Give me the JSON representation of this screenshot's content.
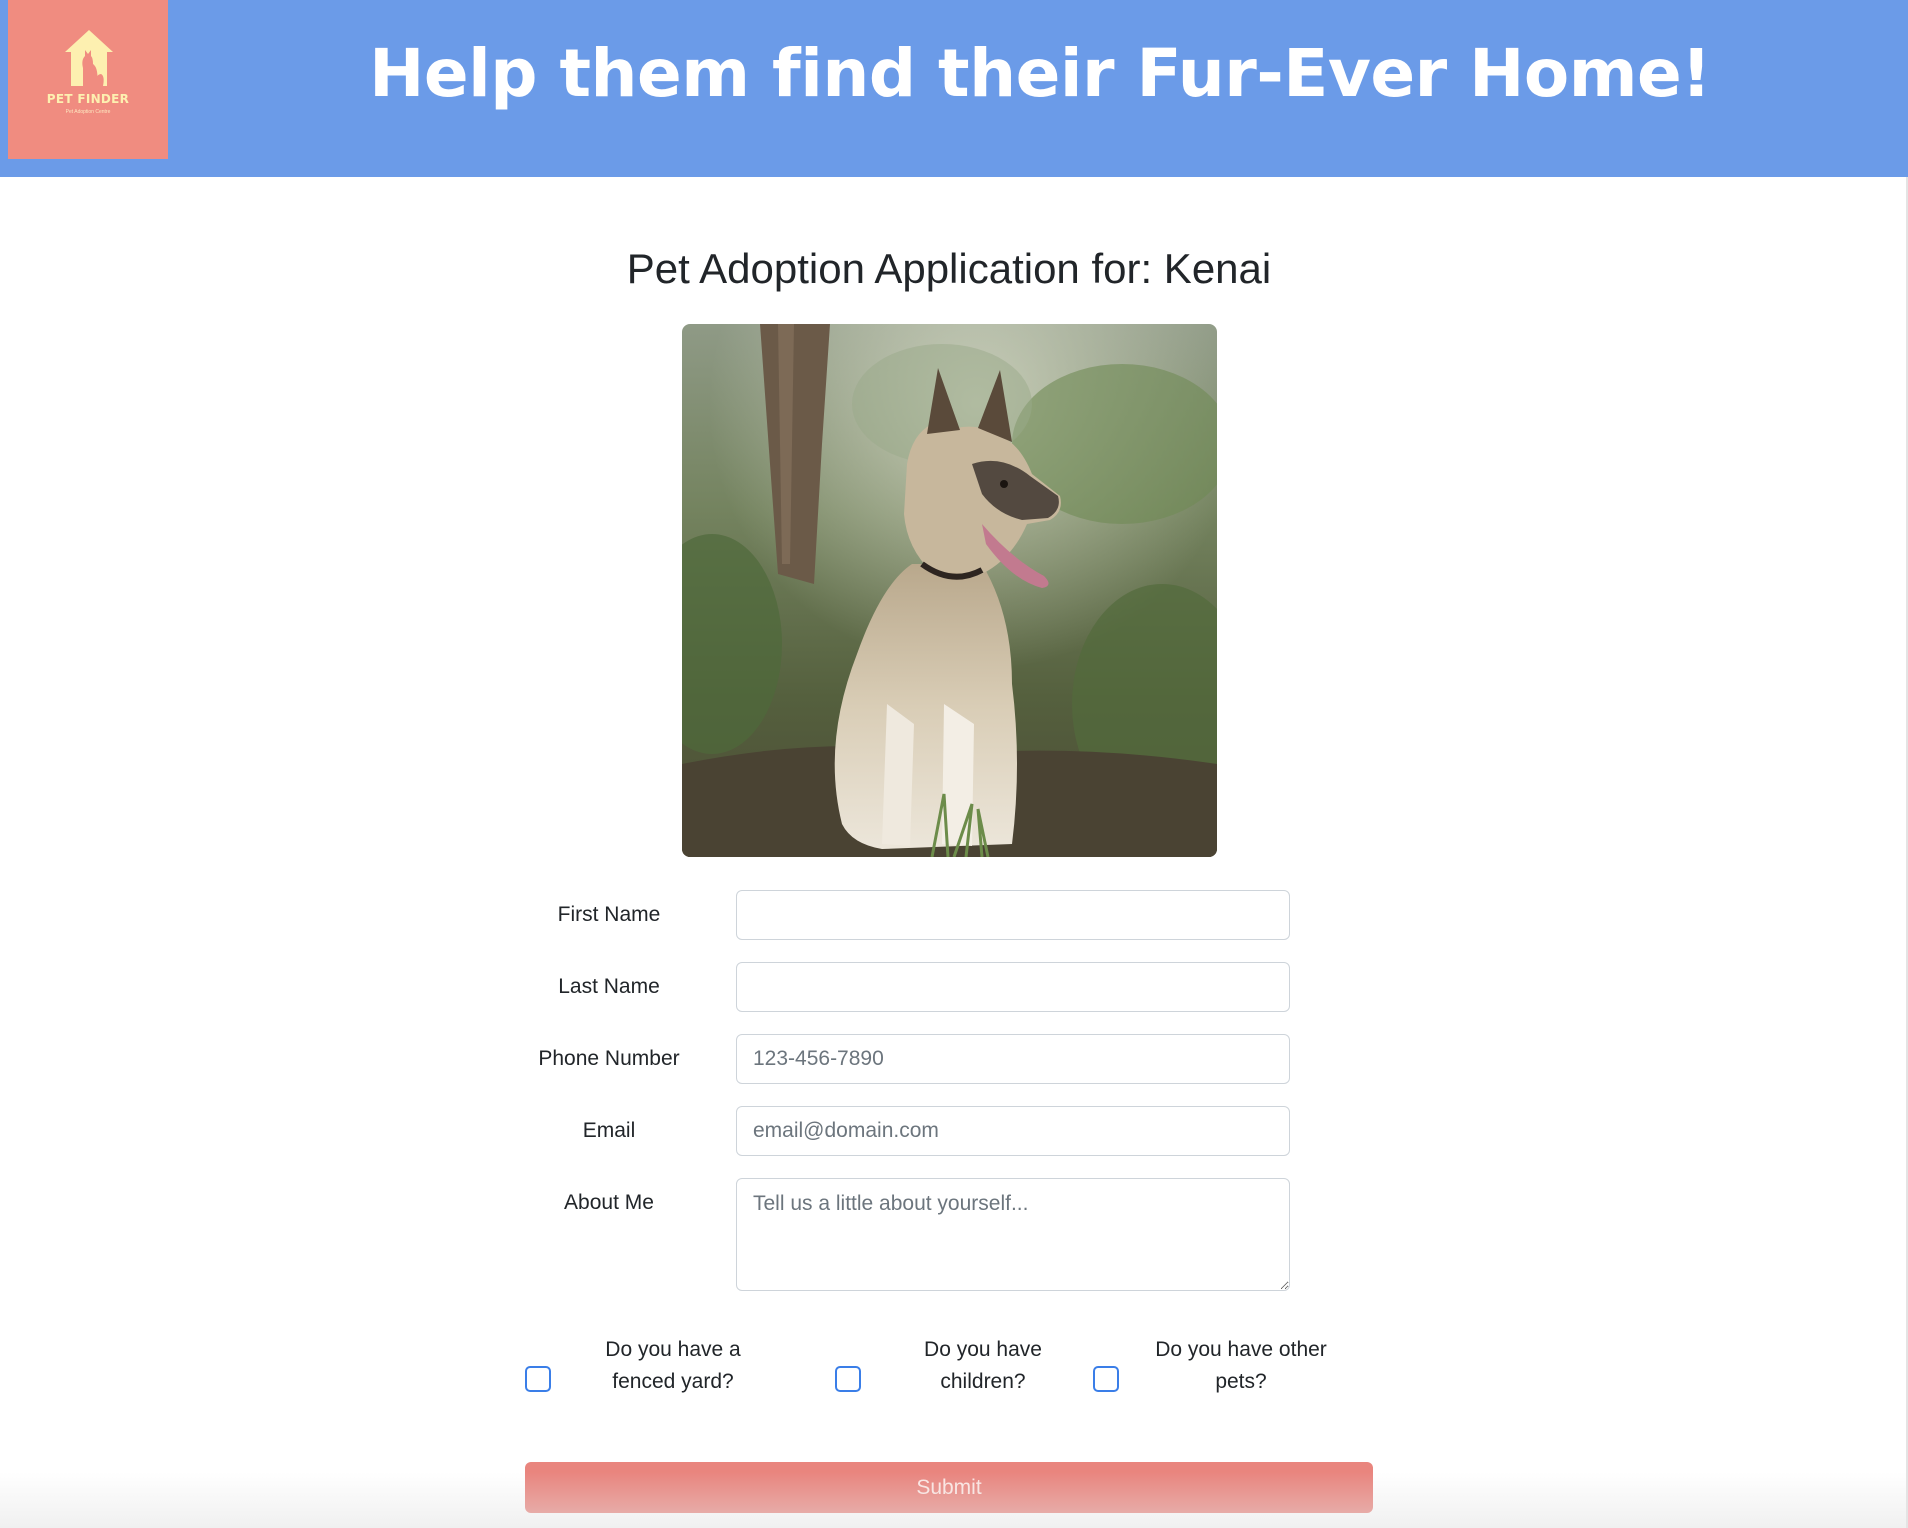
{
  "header": {
    "logo_title": "PET FINDER",
    "logo_subtitle": "Pet Adoption Centre",
    "headline": "Help them find their Fur-Ever Home!"
  },
  "main": {
    "title": "Pet Adoption Application for: Kenai"
  },
  "form": {
    "first_name": {
      "label": "First Name",
      "value": "",
      "placeholder": ""
    },
    "last_name": {
      "label": "Last Name",
      "value": "",
      "placeholder": ""
    },
    "phone": {
      "label": "Phone Number",
      "value": "",
      "placeholder": "123-456-7890"
    },
    "email": {
      "label": "Email",
      "value": "",
      "placeholder": "email@domain.com"
    },
    "about": {
      "label": "About Me",
      "value": "",
      "placeholder": "Tell us a little about yourself..."
    },
    "checkboxes": [
      {
        "line1": "Do you have a",
        "line2": "fenced yard?",
        "checked": false
      },
      {
        "line1": "Do you have",
        "line2": "children?",
        "checked": false
      },
      {
        "line1": "Do you have other",
        "line2": "pets?",
        "checked": false
      }
    ],
    "submit_label": "Submit"
  },
  "colors": {
    "header_bg": "#6b9be8",
    "logo_bg": "#f08c80",
    "submit_bg": "#e9857e",
    "checkbox_border": "#3a7ee8"
  }
}
